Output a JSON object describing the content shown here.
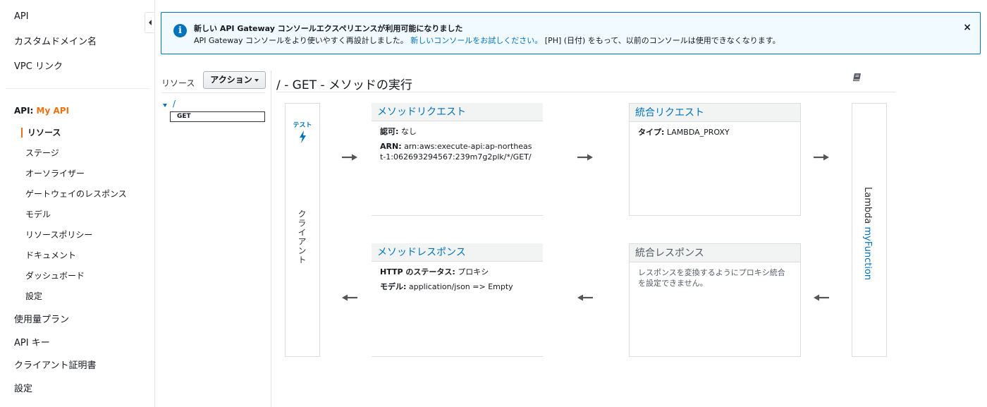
{
  "sidebar": {
    "top_links": [
      "API",
      "カスタムドメイン名",
      "VPC リンク"
    ],
    "api_prefix": "API:",
    "api_name": "My API",
    "sub_items": [
      "リソース",
      "ステージ",
      "オーソライザー",
      "ゲートウェイのレスポンス",
      "モデル",
      "リソースポリシー",
      "ドキュメント",
      "ダッシュボード",
      "設定"
    ],
    "active_item": "リソース",
    "bottom_links": [
      "使用量プラン",
      "API キー",
      "クライアント証明書",
      "設定"
    ]
  },
  "banner": {
    "title": "新しい API Gateway コンソールエクスペリエンスが利用可能になりました",
    "text_before": "API Gateway コンソールをより使いやすく再設計しました。",
    "link": "新しいコンソールをお試しください。",
    "text_after": "[PH] (日付) をもって、以前のコンソールは使用できなくなります。",
    "close": "×"
  },
  "resources": {
    "label": "リソース",
    "action_button": "アクション",
    "root": "/",
    "method": "GET"
  },
  "execution": {
    "title": "/ - GET - メソッドの実行",
    "client": {
      "test_label": "テスト",
      "label": "クライアント"
    },
    "method_request": {
      "title": "メソッドリクエスト",
      "auth_label": "認可:",
      "auth_value": "なし",
      "arn_label": "ARN:",
      "arn_value": "arn:aws:execute-api:ap-northeast-1:062693294567:239m7g2plk/*/GET/"
    },
    "integration_request": {
      "title": "統合リクエスト",
      "type_label": "タイプ:",
      "type_value": "LAMBDA_PROXY"
    },
    "method_response": {
      "title": "メソッドレスポンス",
      "status_label": "HTTP のステータス:",
      "status_value": "プロキシ",
      "model_label": "モデル:",
      "model_value": "application/json => Empty"
    },
    "integration_response": {
      "title": "統合レスポンス",
      "note": "レスポンスを変換するようにプロキシ統合を設定できません。"
    },
    "lambda": {
      "prefix": "Lambda",
      "function": "myFunction"
    }
  },
  "colors": {
    "accent": "#ec7211",
    "link": "#0073bb",
    "banner_bg": "#f1faff"
  },
  "icons": {
    "info": "info-icon",
    "book": "book-icon",
    "bolt": "lightning-bolt-icon",
    "close": "close-icon"
  }
}
